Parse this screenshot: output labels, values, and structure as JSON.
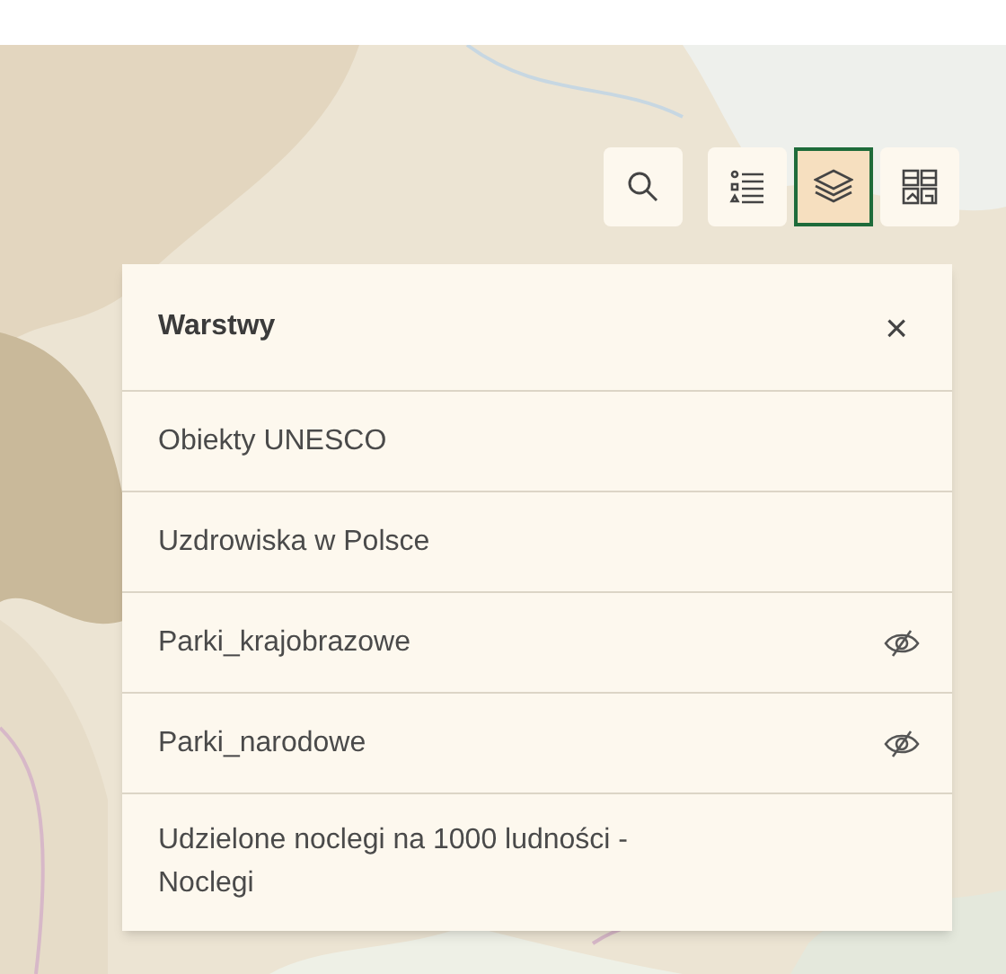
{
  "toolbar": {
    "search": {
      "selected": false
    },
    "views": [
      {
        "kind": "legend",
        "selected": false
      },
      {
        "kind": "layers",
        "selected": true
      },
      {
        "kind": "basemap",
        "selected": false
      }
    ]
  },
  "panel": {
    "title": "Warstwy",
    "close": "×",
    "layers": [
      {
        "label": "Obiekty UNESCO",
        "visible": true
      },
      {
        "label": "Uzdrowiska w Polsce",
        "visible": true
      },
      {
        "label": "Parki_krajobrazowe",
        "visible": false
      },
      {
        "label": "Parki_narodowe",
        "visible": false
      },
      {
        "label": "Udzielone noclegi na 1000 ludności - Noclegi",
        "visible": true
      }
    ]
  }
}
